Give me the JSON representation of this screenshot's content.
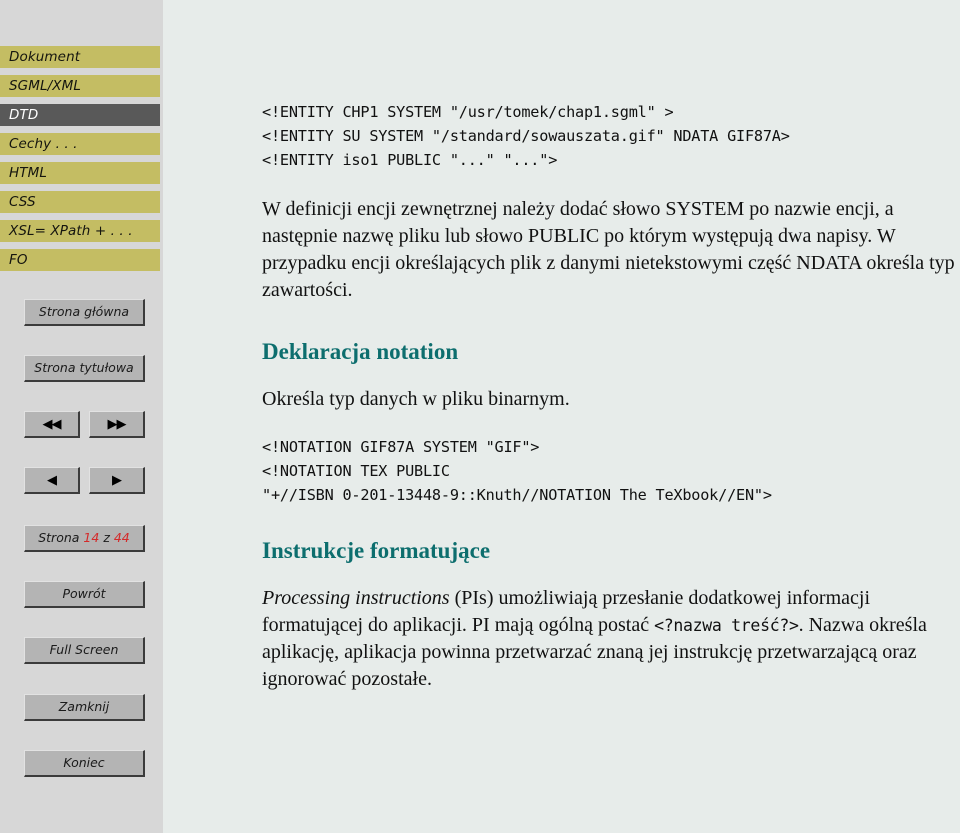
{
  "sidebar": {
    "nav_tabs": [
      {
        "label": "Dokument",
        "active": false
      },
      {
        "label": "SGML/XML",
        "active": false
      },
      {
        "label": "DTD",
        "active": true
      },
      {
        "label": "Cechy . . .",
        "active": false
      },
      {
        "label": "HTML",
        "active": false
      },
      {
        "label": "CSS",
        "active": false
      },
      {
        "label": "XSL= XPath + . . .",
        "active": false
      },
      {
        "label": "FO",
        "active": false
      }
    ],
    "buttons": {
      "home": "Strona główna",
      "title_page": "Strona tytułowa",
      "first": "◀◀",
      "last": "▶▶",
      "prev": "◀",
      "next": "▶",
      "page_prefix": "Strona",
      "page_current": "14",
      "page_middle": "z",
      "page_total": "44",
      "back": "Powrót",
      "fullscreen": "Full Screen",
      "close": "Zamknij",
      "end": "Koniec"
    }
  },
  "content": {
    "code_entity": "<!ENTITY CHP1 SYSTEM \"/usr/tomek/chap1.sgml\" >\n<!ENTITY SU SYSTEM \"/standard/sowauszata.gif\" NDATA GIF87A>\n<!ENTITY iso1 PUBLIC \"...\" \"...\">",
    "paragraph_entity": "W definicji encji zewnętrznej należy dodać słowo SYSTEM po nazwie encji, a następnie nazwę pliku lub słowo PUBLIC po którym występują dwa napisy. W przypadku encji określających plik z danymi nietekstowymi część NDATA określa typ zawartości.",
    "heading_notation": "Deklaracja notation",
    "paragraph_notation": "Określa typ danych w pliku binarnym.",
    "code_notation": "<!NOTATION GIF87A SYSTEM \"GIF\">\n<!NOTATION TEX PUBLIC\n\"+//ISBN 0-201-13448-9::Knuth//NOTATION The TeXbook//EN\">",
    "heading_pi": "Instrukcje formatujące",
    "pi_italic": "Processing instructions",
    "pi_part1": " (PIs) umożliwiają przesłanie dodatkowej informacji formatującej do aplikacji. PI mają ogólną postać ",
    "pi_code": "<?nazwa treść?>",
    "pi_part2": ". Nazwa określa aplikację, aplikacja powinna przetwarzać znaną jej instrukcję przetwarzającą oraz ignorować pozostałe."
  },
  "colors": {
    "sidebar_bg": "#d7d7d7",
    "content_bg": "#e7ecea",
    "tab_bg": "#c4bd63",
    "tab_active_bg": "#595959",
    "button_bg": "#b4b4b4",
    "heading": "#0d6e6e",
    "page_number": "#d42a2a"
  }
}
